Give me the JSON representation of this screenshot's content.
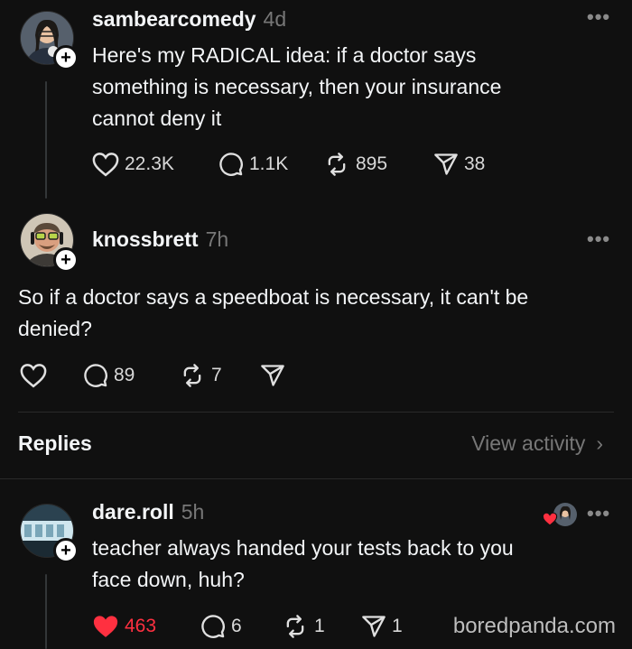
{
  "post": {
    "username": "sambearcomedy",
    "time": "4d",
    "text_lines": [
      "Here's my RADICAL idea: if a doctor says",
      "something is necessary, then your  insurance",
      "cannot deny it"
    ],
    "likes": "22.3K",
    "comments": "1.1K",
    "reposts": "895",
    "shares": "38",
    "more_icon": "more-dots-icon"
  },
  "reply": {
    "username": "knossbrett",
    "time": "7h",
    "text_lines": [
      "So if a doctor says a speedboat is necessary, it can't be",
      "denied?"
    ],
    "comments": "89",
    "reposts": "7"
  },
  "section": {
    "replies_label": "Replies",
    "view_activity_label": "View activity",
    "chevron": "›"
  },
  "comment": {
    "username": "dare.roll",
    "time": "5h",
    "text_lines": [
      "teacher always handed your tests back to you",
      "face down, huh?"
    ],
    "likes": "463",
    "comments": "6",
    "reposts": "1",
    "shares": "1"
  },
  "watermark": "boredpanda.com",
  "colors": {
    "background": "#101010",
    "liked_red": "#ff3040",
    "muted": "#777777"
  }
}
